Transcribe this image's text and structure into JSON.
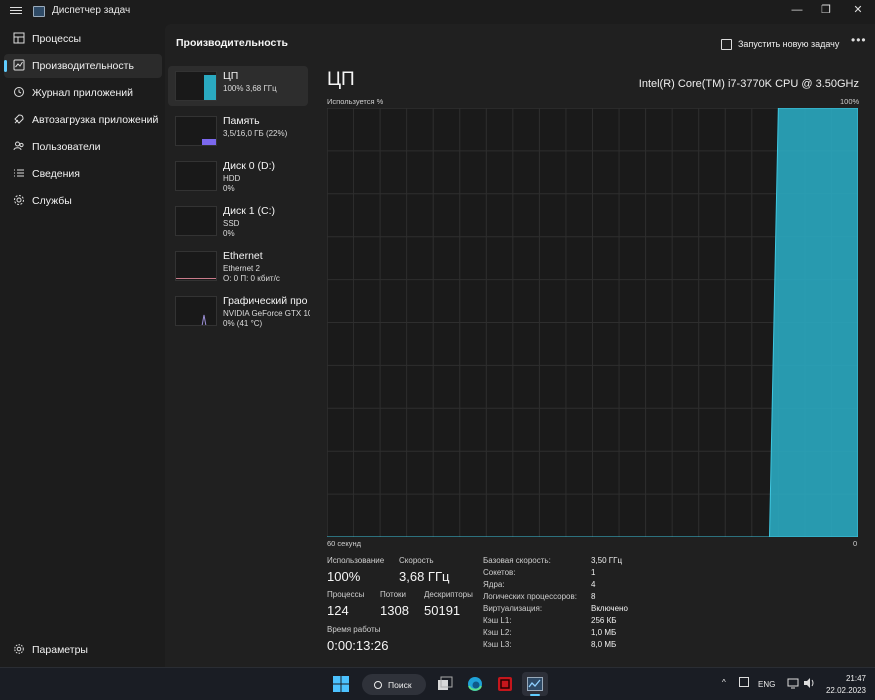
{
  "window": {
    "title": "Диспетчер задач",
    "controls": {
      "minimize": "—",
      "maximize": "❐",
      "close": "✕"
    }
  },
  "sidebar": {
    "items": [
      {
        "label": "Процессы",
        "icon": "processes-icon"
      },
      {
        "label": "Производительность",
        "icon": "performance-icon",
        "active": true
      },
      {
        "label": "Журнал приложений",
        "icon": "history-icon"
      },
      {
        "label": "Автозагрузка приложений",
        "icon": "startup-icon"
      },
      {
        "label": "Пользователи",
        "icon": "users-icon"
      },
      {
        "label": "Сведения",
        "icon": "details-icon"
      },
      {
        "label": "Службы",
        "icon": "services-icon"
      }
    ],
    "settings": {
      "label": "Параметры",
      "icon": "gear-icon"
    }
  },
  "header": {
    "title": "Производительность",
    "run_task": "Запустить новую задачу",
    "more": "•••"
  },
  "devices": [
    {
      "name": "ЦП",
      "sub1": "100% 3,68 ГГц",
      "sub2": "",
      "color": "#2aa9c0"
    },
    {
      "name": "Память",
      "sub1": "3,5/16,0 ГБ (22%)",
      "sub2": "",
      "color": "#7b68ee"
    },
    {
      "name": "Диск 0 (D:)",
      "sub1": "HDD",
      "sub2": "0%",
      "color": "#6fbf3a"
    },
    {
      "name": "Диск 1 (C:)",
      "sub1": "SSD",
      "sub2": "0%",
      "color": "#6fbf3a"
    },
    {
      "name": "Ethernet",
      "sub1": "Ethernet 2",
      "sub2": "О: 0 П: 0 кбит/с",
      "color": "#c97b8a"
    },
    {
      "name": "Графический про",
      "sub1": "NVIDIA GeForce GTX 107",
      "sub2": "0% (41 °C)",
      "color": "#9b8fd6"
    }
  ],
  "cpu": {
    "title": "ЦП",
    "model": "Intel(R) Core(TM) i7-3770K CPU @ 3.50GHz",
    "graph_label_top_left": "Используется %",
    "graph_label_top_right": "100%",
    "graph_label_bottom_left": "60 секунд",
    "graph_label_bottom_right": "0",
    "accent_color": "#2aa9c0"
  },
  "chart_data": {
    "type": "area",
    "x": [
      60,
      50,
      10,
      9,
      8,
      0
    ],
    "values": [
      0,
      0,
      0,
      100,
      100,
      100
    ],
    "xlabel": "60 секунд",
    "ylabel": "Используется %",
    "ylim": [
      0,
      100
    ],
    "grid": true
  },
  "stats": {
    "usage_label": "Использование",
    "usage_value": "100%",
    "speed_label": "Скорость",
    "speed_value": "3,68 ГГц",
    "processes_label": "Процессы",
    "processes_value": "124",
    "threads_label": "Потоки",
    "threads_value": "1308",
    "handles_label": "Дескрипторы",
    "handles_value": "50191",
    "uptime_label": "Время работы",
    "uptime_value": "0:00:13:26"
  },
  "specs": [
    {
      "key": "Базовая скорость:",
      "value": "3,50 ГГц"
    },
    {
      "key": "Сокетов:",
      "value": "1"
    },
    {
      "key": "Ядра:",
      "value": "4"
    },
    {
      "key": "Логических процессоров:",
      "value": "8"
    },
    {
      "key": "Виртуализация:",
      "value": "Включено"
    },
    {
      "key": "Кэш L1:",
      "value": "256 КБ"
    },
    {
      "key": "Кэш L2:",
      "value": "1,0 МБ"
    },
    {
      "key": "Кэш L3:",
      "value": "8,0 МБ"
    }
  ],
  "taskbar": {
    "search_label": "Поиск",
    "language": "ENG",
    "time": "21:47",
    "date": "22.02.2023",
    "tray_chevron": "^"
  }
}
